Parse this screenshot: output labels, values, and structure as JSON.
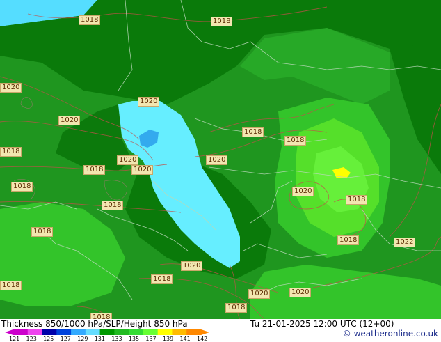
{
  "footer": {
    "title": "Thickness 850/1000 hPa/SLP/Height 850 hPa",
    "datetime": "Tu 21-01-2025 12:00 UTC (12+00)",
    "credit": "© weatheronline.co.uk"
  },
  "scale": {
    "labels": [
      "121",
      "123",
      "125",
      "127",
      "129",
      "131",
      "133",
      "135",
      "137",
      "139",
      "141",
      "142"
    ],
    "colors": [
      "#cc00cc",
      "#ee44ee",
      "#0000aa",
      "#0044dd",
      "#33aaff",
      "#66ddff",
      "#009900",
      "#22bb22",
      "#33dd33",
      "#66ff33",
      "#ffff00",
      "#ffbb00",
      "#ff8800"
    ]
  },
  "isobars": {
    "labels": [
      "1018",
      "1018",
      "1020",
      "1020",
      "1020",
      "1018",
      "1018",
      "1020",
      "1018",
      "1020",
      "1020",
      "1018",
      "1018",
      "1018",
      "1018",
      "1020",
      "1018",
      "1018",
      "1018",
      "1022",
      "1018",
      "1020",
      "1018",
      "1018",
      "1020",
      "1020",
      "1018"
    ]
  },
  "fill_colors": {
    "dark_green": "#0a7a0a",
    "mid_green": "#1f961f",
    "light_green": "#33c42a",
    "bright_green": "#55e02a",
    "lime": "#66f03a",
    "yellow": "#ffff00",
    "cyan": "#66eeff",
    "blue": "#33aaee",
    "top_cyan": "#55ddff"
  }
}
